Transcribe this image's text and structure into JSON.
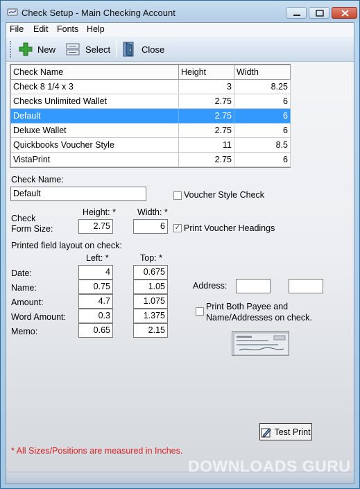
{
  "window": {
    "title": "Check Setup - Main Checking Account"
  },
  "menu": {
    "file": "File",
    "edit": "Edit",
    "fonts": "Fonts",
    "help": "Help"
  },
  "toolbar": {
    "new_label": "New",
    "select_label": "Select",
    "close_label": "Close"
  },
  "grid": {
    "headers": [
      "Check Name",
      "Height",
      "Width"
    ],
    "rows": [
      {
        "name": "Check 8 1/4 x 3",
        "height": "3",
        "width": "8.25"
      },
      {
        "name": "Checks Unlimited Wallet",
        "height": "2.75",
        "width": "6"
      },
      {
        "name": "Default",
        "height": "2.75",
        "width": "6"
      },
      {
        "name": "Deluxe Wallet",
        "height": "2.75",
        "width": "6"
      },
      {
        "name": "Quickbooks Voucher Style",
        "height": "11",
        "width": "8.5"
      },
      {
        "name": "VistaPrint",
        "height": "2.75",
        "width": "6"
      }
    ],
    "selected_row": "Default"
  },
  "form": {
    "check_name_label": "Check Name:",
    "check_name_value": "Default",
    "voucher_style_label": "Voucher Style Check",
    "voucher_style_checked": false,
    "check_form_size_label_1": "Check",
    "check_form_size_label_2": "Form Size:",
    "height_label": "Height: *",
    "width_label": "Width: *",
    "height_value": "2.75",
    "width_value": "6",
    "print_voucher_headings_label": "Print Voucher Headings",
    "print_voucher_headings_checked": true,
    "layout_heading": "Printed field layout on check:",
    "left_label": "Left: *",
    "top_label": "Top: *",
    "fields": [
      {
        "label": "Date:",
        "left": "4",
        "top": "0.675"
      },
      {
        "label": "Name:",
        "left": "0.75",
        "top": "1.05"
      },
      {
        "label": "Amount:",
        "left": "4.7",
        "top": "1.075"
      },
      {
        "label": "Word Amount:",
        "left": "0.3",
        "top": "1.375"
      },
      {
        "label": "Memo:",
        "left": "0.65",
        "top": "2.15"
      }
    ],
    "address_label": "Address:",
    "address_left_value": "",
    "address_top_value": "",
    "print_both_label_1": "Print Both Payee and",
    "print_both_label_2": "Name/Addresses on check.",
    "print_both_checked": false,
    "test_print_label": "Test Print",
    "note": "* All Sizes/Positions are measured in Inches."
  },
  "watermark": {
    "text": "DOWNLOADS GURU"
  },
  "colors": {
    "selection": "#3399ff",
    "note": "#dd2222",
    "new_icon": "#3aa13a"
  }
}
